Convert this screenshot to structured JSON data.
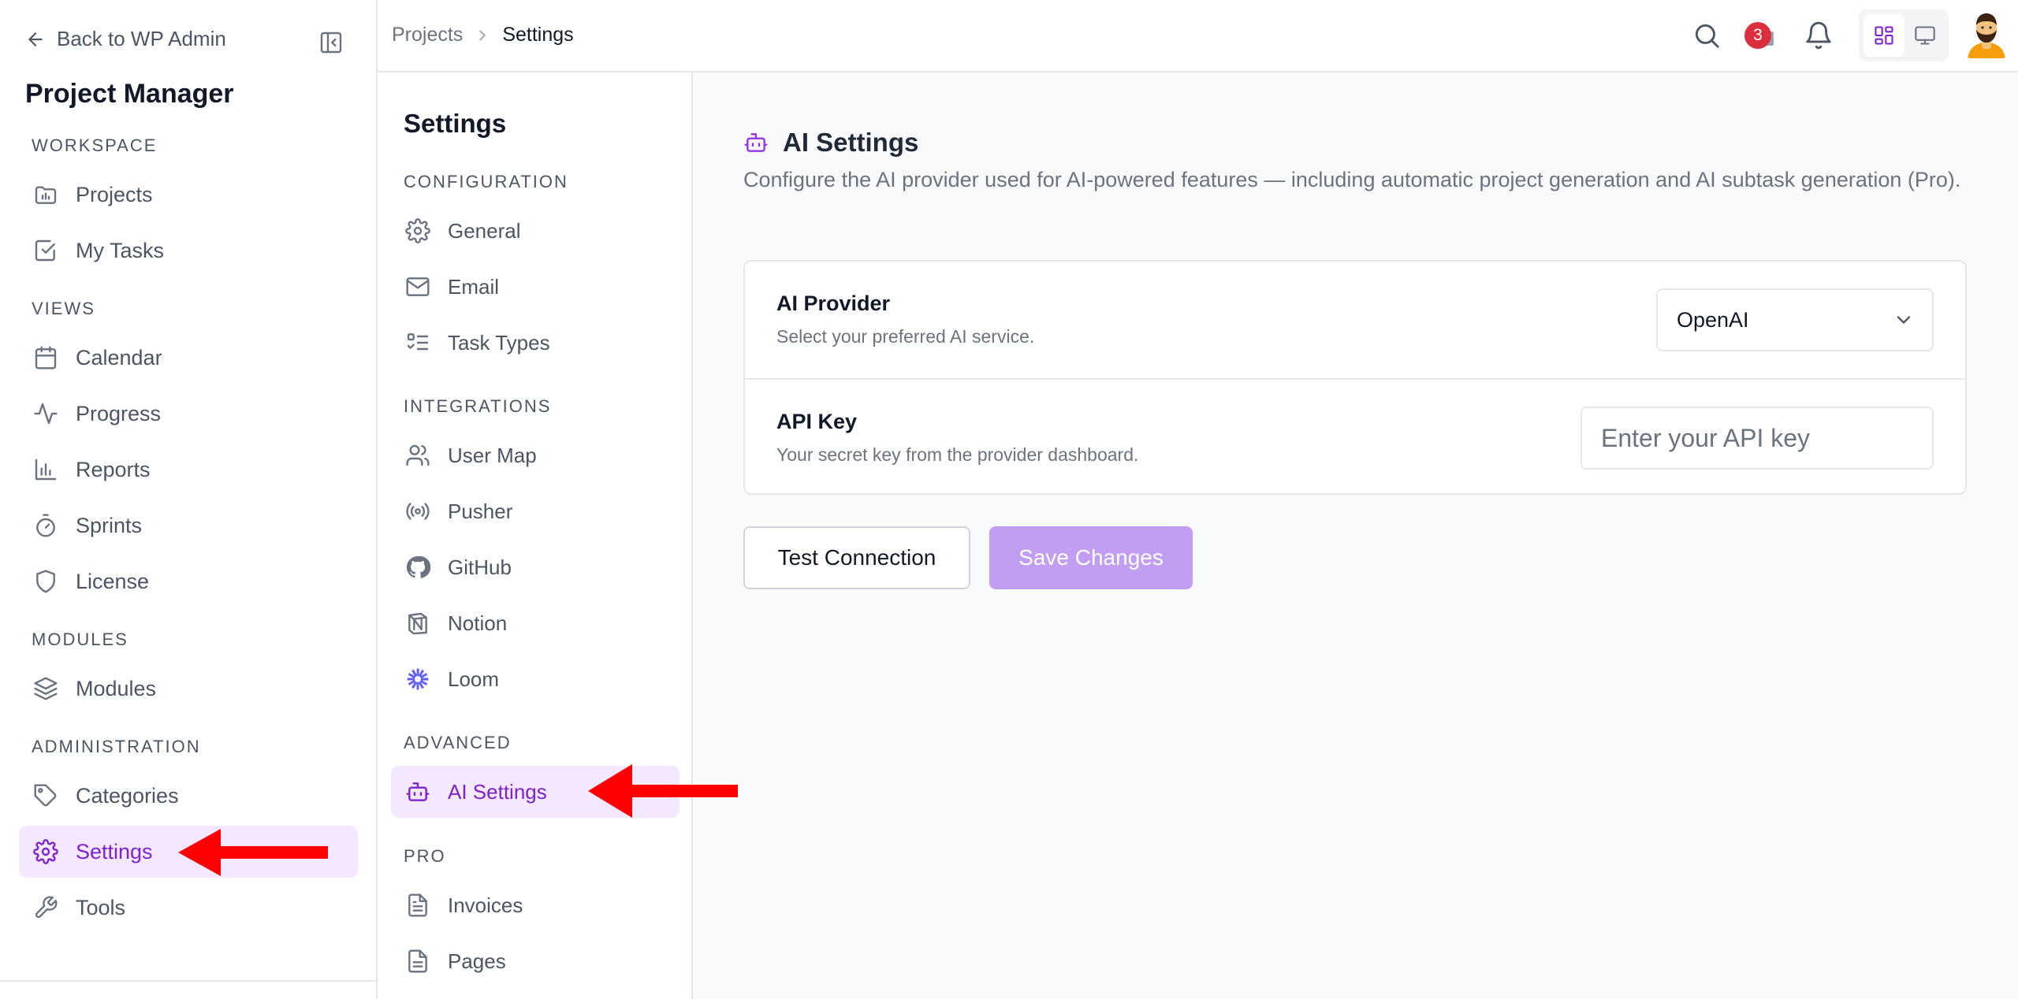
{
  "sidebar": {
    "back_label": "Back to WP Admin",
    "app_title": "Project Manager",
    "sections": {
      "workspace": "WORKSPACE",
      "views": "VIEWS",
      "modules": "MODULES",
      "administration": "ADMINISTRATION"
    },
    "items": {
      "projects": "Projects",
      "my_tasks": "My Tasks",
      "calendar": "Calendar",
      "progress": "Progress",
      "reports": "Reports",
      "sprints": "Sprints",
      "license": "License",
      "modules": "Modules",
      "categories": "Categories",
      "settings": "Settings",
      "tools": "Tools"
    },
    "active_item": "settings"
  },
  "topbar": {
    "breadcrumb": [
      "Projects",
      "Settings"
    ],
    "notification_count": "3"
  },
  "subnav": {
    "title": "Settings",
    "sections": {
      "configuration": "CONFIGURATION",
      "integrations": "INTEGRATIONS",
      "advanced": "ADVANCED",
      "pro": "PRO"
    },
    "items": {
      "general": "General",
      "email": "Email",
      "task_types": "Task Types",
      "user_map": "User Map",
      "pusher": "Pusher",
      "github": "GitHub",
      "notion": "Notion",
      "loom": "Loom",
      "ai_settings": "AI Settings",
      "invoices": "Invoices",
      "pages": "Pages"
    },
    "active_item": "ai_settings"
  },
  "main": {
    "title": "AI Settings",
    "description": "Configure the AI provider used for AI-powered features — including automatic project generation and AI subtask generation (Pro).",
    "provider": {
      "label": "AI Provider",
      "help": "Select your preferred AI service.",
      "value": "OpenAI"
    },
    "api_key": {
      "label": "API Key",
      "help": "Your secret key from the provider dashboard.",
      "value": "",
      "placeholder": "Enter your API key"
    },
    "buttons": {
      "test": "Test Connection",
      "save": "Save Changes"
    }
  },
  "colors": {
    "accent": "#7e22ce",
    "accent_bg": "#f3e8ff",
    "primary_disabled": "#c29ef2",
    "badge": "#dc2f3d",
    "annotation_arrow": "#ff0000"
  }
}
